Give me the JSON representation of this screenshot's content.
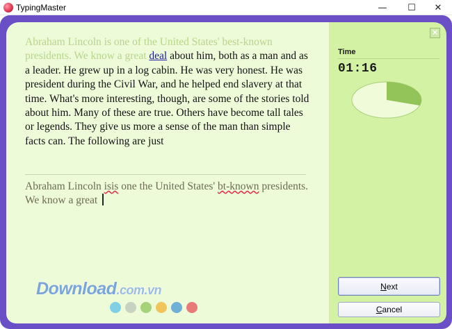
{
  "window": {
    "title": "TypingMaster",
    "minimize_glyph": "—",
    "maximize_glyph": "☐",
    "close_glyph": "✕"
  },
  "lesson": {
    "source_typed": "Abraham Lincoln is one of the United States' best-known presidents. We know a great ",
    "source_current": "deal",
    "source_remaining": " about him, both as a man and as a leader. He grew up in a log cabin. He was very honest. He was president during the Civil War, and he helped end slavery at that time. What's more interesting, though, are some of the stories told about him. Many of these are true. Others have become tall tales or legends. They give us more a sense of the man than simple facts can. The following are just",
    "input_segments": [
      {
        "text": "Abraham Lincoln  ",
        "error": false
      },
      {
        "text": "isis",
        "error": true
      },
      {
        "text": " one the United States' ",
        "error": false
      },
      {
        "text": "bt-known",
        "error": true
      },
      {
        "text": " presidents. We know a great ",
        "error": false
      }
    ]
  },
  "side_panel": {
    "close_glyph": "✕",
    "time_label": "Time",
    "time_value": "01:16",
    "time_progress": 0.3,
    "pie_colors": {
      "elapsed": "#93c45a",
      "remaining": "#f0fbd9",
      "outline": "#a8cf7a"
    }
  },
  "buttons": {
    "next_first": "N",
    "next_rest": "ext",
    "cancel_first": "C",
    "cancel_rest": "ancel"
  },
  "watermark": {
    "main": "Download",
    "suffix": ".com.vn",
    "dot_colors": [
      "#7fd0e6",
      "#c8d2c0",
      "#a6d37a",
      "#f2c45c",
      "#6fb0d6",
      "#e87a7a"
    ]
  }
}
